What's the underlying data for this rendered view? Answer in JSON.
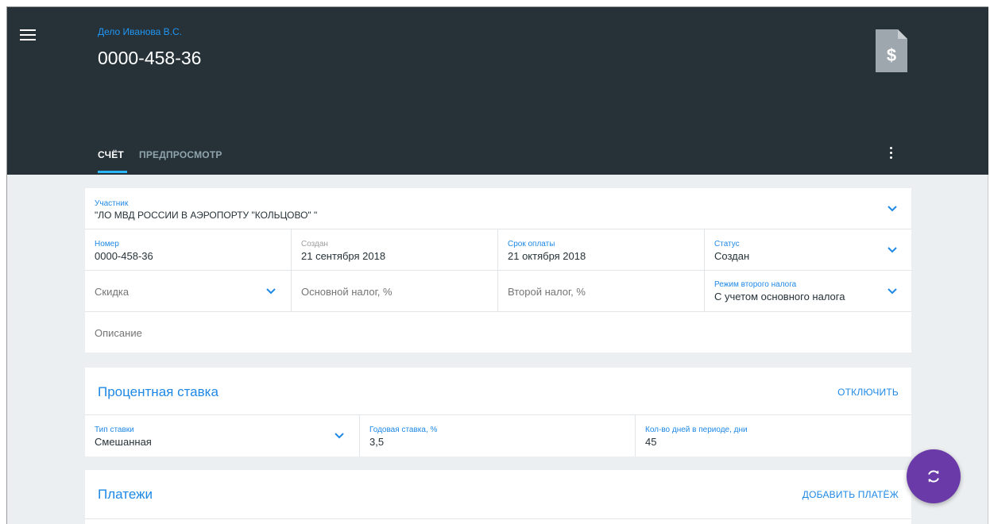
{
  "header": {
    "case_label": "Дело Иванова В.С.",
    "title": "0000-458-36",
    "doc_icon": "invoice-dollar-icon",
    "menu_icon": "hamburger-menu-icon",
    "more_icon": "more-vertical-icon",
    "colors": {
      "background": "#263238",
      "accent": "#2196f3",
      "tab_indicator": "#29b6f6"
    }
  },
  "tabs": [
    {
      "label": "СЧЁТ",
      "active": true
    },
    {
      "label": "ПРЕДПРОСМОТР",
      "active": false
    }
  ],
  "invoice": {
    "participant": {
      "label": "Участник",
      "value": "\"ЛО МВД  РОССИИ В АЭРОПОРТУ \"КОЛЬЦОВО\" \""
    },
    "number": {
      "label": "Номер",
      "value": "0000-458-36"
    },
    "created": {
      "label": "Создан",
      "value": "21 сентября 2018"
    },
    "due_date": {
      "label": "Срок оплаты",
      "value": "21 октября 2018"
    },
    "status": {
      "label": "Статус",
      "value": "Создан"
    },
    "discount": {
      "placeholder": "Скидка"
    },
    "main_tax": {
      "placeholder": "Основной налог, %"
    },
    "second_tax": {
      "placeholder": "Второй налог, %"
    },
    "second_tax_mode": {
      "label": "Режим второго налога",
      "value": "С учетом основного налога"
    },
    "description": {
      "placeholder": "Описание"
    }
  },
  "interest": {
    "title": "Процентная ставка",
    "action": "ОТКЛЮЧИТЬ",
    "rate_type": {
      "label": "Тип ставки",
      "value": "Смешанная"
    },
    "annual_rate": {
      "label": "Годовая ставка, %",
      "value": "3,5"
    },
    "days_in_period": {
      "label": "Кол-во дней в периоде, дни",
      "value": "45"
    }
  },
  "payments": {
    "title": "Платежи",
    "action": "ДОБАВИТЬ ПЛАТЁЖ"
  },
  "fab": {
    "icon": "sync-icon",
    "color": "#6a3ba8"
  }
}
